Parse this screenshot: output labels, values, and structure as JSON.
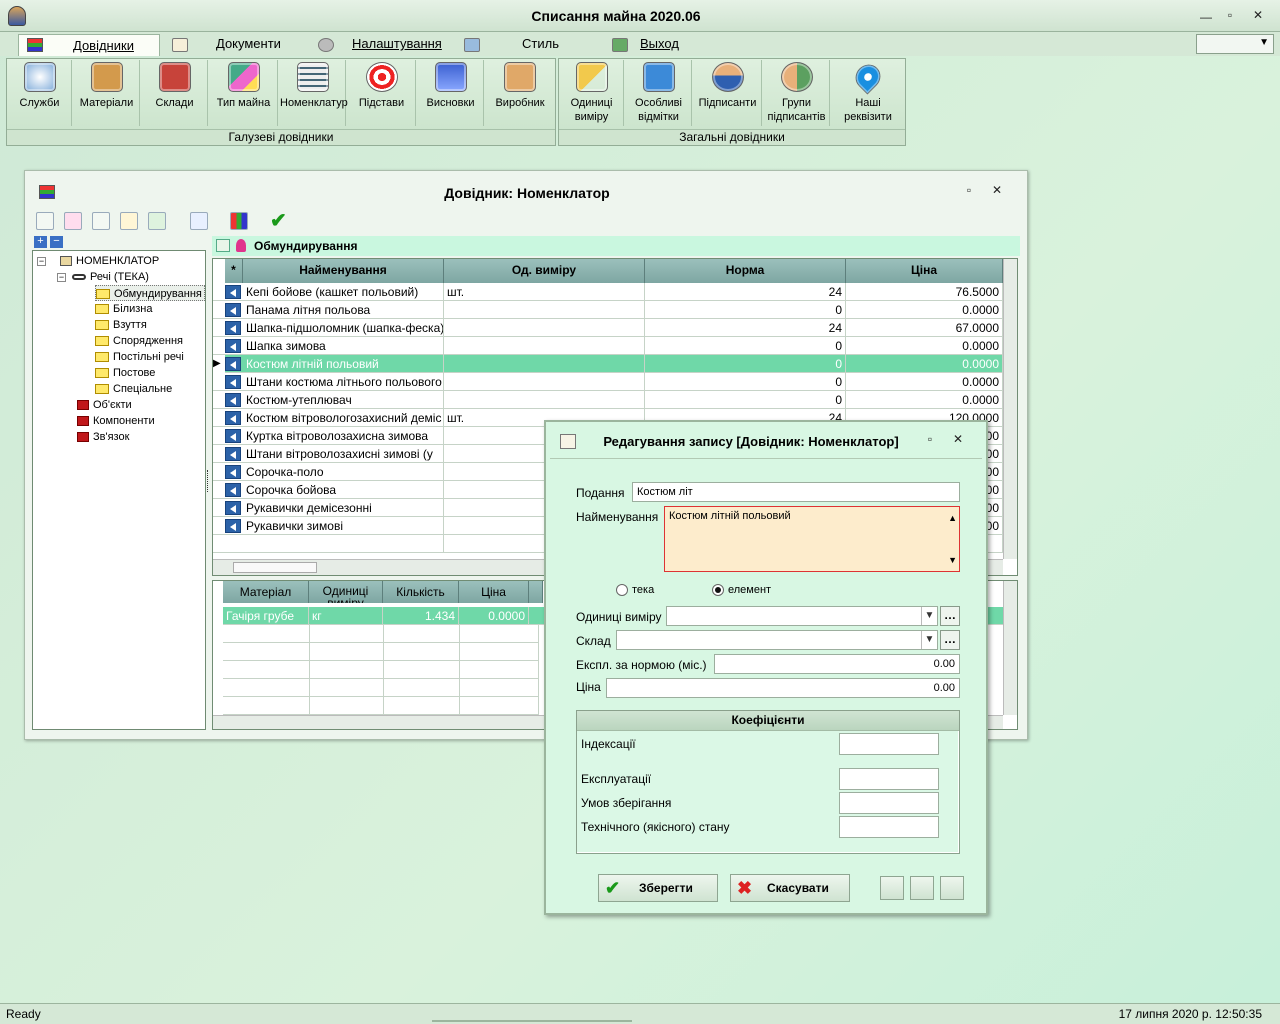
{
  "app": {
    "title": "Списання майна 2020.06"
  },
  "menu": [
    {
      "label": "Довідники",
      "icon": "books-icon"
    },
    {
      "label": "Документи",
      "icon": "document-icon"
    },
    {
      "label": "Налаштування",
      "icon": "settings-gear-icon"
    },
    {
      "label": "Стиль",
      "icon": "style-brush-icon"
    },
    {
      "label": "Выход",
      "icon": "exit-door-icon"
    }
  ],
  "ribbon": {
    "groups": [
      {
        "label": "Галузеві довідники",
        "buttons": [
          "Служби",
          "Матеріали",
          "Склади",
          "Тип майна",
          "Номенклатур",
          "Підстави",
          "Висновки",
          "Виробник"
        ]
      },
      {
        "label": "Загальні довідники",
        "buttons": [
          "Одиниці виміру",
          "Особливі відмітки",
          "Підписанти",
          "Групи підписантів",
          "Наші реквізити"
        ]
      }
    ]
  },
  "child": {
    "title": "Довідник: Номенклатор",
    "tree": [
      {
        "label": "НОМЕНКЛАТОР",
        "level": 0,
        "kind": "home"
      },
      {
        "label": "Речі (ТЕКА)",
        "level": 1,
        "kind": "glasses"
      },
      {
        "label": "Обмундирування",
        "level": 2,
        "kind": "folder"
      },
      {
        "label": "Білизна",
        "level": 2,
        "kind": "folder"
      },
      {
        "label": "Взуття",
        "level": 2,
        "kind": "folder"
      },
      {
        "label": "Спорядження",
        "level": 2,
        "kind": "folder"
      },
      {
        "label": "Постільні речі",
        "level": 2,
        "kind": "folder"
      },
      {
        "label": "Постове",
        "level": 2,
        "kind": "folder"
      },
      {
        "label": "Спеціальне",
        "level": 2,
        "kind": "folder"
      },
      {
        "label": "Об'єкти",
        "level": 1,
        "kind": "redbook"
      },
      {
        "label": "Компоненти",
        "level": 1,
        "kind": "redbook"
      },
      {
        "label": "Зв'язок",
        "level": 1,
        "kind": "redbook"
      }
    ],
    "path_label": "Обмундирування",
    "grid": {
      "headers": [
        "*",
        "Найменування",
        "Од. виміру",
        "Норма",
        "Ціна"
      ],
      "rows": [
        {
          "name": "Кепі бойове (кашкет польовий)",
          "unit": "шт.",
          "norm": "24",
          "price": "76.5000"
        },
        {
          "name": "Панама літня польова",
          "unit": "",
          "norm": "0",
          "price": "0.0000"
        },
        {
          "name": "Шапка-підшоломник (шапка-феска)",
          "unit": "",
          "norm": "24",
          "price": "67.0000"
        },
        {
          "name": "Шапка зимова",
          "unit": "",
          "norm": "0",
          "price": "0.0000"
        },
        {
          "name": "Костюм літній польовий",
          "unit": "",
          "norm": "0",
          "price": "0.0000",
          "selected": true
        },
        {
          "name": "Штани костюма літнього польового",
          "unit": "",
          "norm": "0",
          "price": "0.0000"
        },
        {
          "name": "Костюм-утеплювач",
          "unit": "",
          "norm": "0",
          "price": "0.0000"
        },
        {
          "name": "Костюм вітровологозахисний деміс",
          "unit": "шт.",
          "norm": "24",
          "price": "120.0000"
        },
        {
          "name": "Куртка вітроволозахисна зимова",
          "unit": "",
          "norm": "",
          "price": "00"
        },
        {
          "name": "Штани вітроволозахисні зимові (у",
          "unit": "",
          "norm": "",
          "price": "00"
        },
        {
          "name": "Сорочка-поло",
          "unit": "",
          "norm": "",
          "price": "00"
        },
        {
          "name": "Сорочка бойова",
          "unit": "",
          "norm": "",
          "price": "00"
        },
        {
          "name": "Рукавички демісезонні",
          "unit": "",
          "norm": "",
          "price": "00"
        },
        {
          "name": "Рукавички зимові",
          "unit": "",
          "norm": "",
          "price": "00"
        }
      ]
    },
    "subgrid": {
      "headers": [
        "Матеріал",
        "Одиниці виміру",
        "Кількість",
        "Ціна"
      ],
      "rows": [
        {
          "material": "Гачіря грубе",
          "unit": "кг",
          "qty": "1.434",
          "price": "0.0000"
        }
      ]
    }
  },
  "dialog": {
    "title": "Редагування запису [Довідник: Номенклатор]",
    "labels": {
      "podannia": "Подання",
      "naimenuvannia": "Найменування",
      "teka": "тека",
      "element": "елемент",
      "units": "Одиниці виміру",
      "sklad": "Склад",
      "expl": "Експл. за нормою (міс.)",
      "price": "Ціна",
      "coef_header": "Коефіцієнти",
      "indexation": "Індексації",
      "exploitation": "Експлуатації",
      "storage": "Умов зберігання",
      "tech": "Технічного (якісного) стану"
    },
    "values": {
      "podannia": "Костюм літ",
      "naimenuvannia": "Костюм літній польовий",
      "expl": "0.00",
      "price": "0.00"
    },
    "buttons": {
      "save": "Зберегти",
      "cancel": "Скасувати"
    }
  },
  "status": {
    "left": "Ready",
    "right": "17 липня 2020 р. 12:50:35"
  }
}
